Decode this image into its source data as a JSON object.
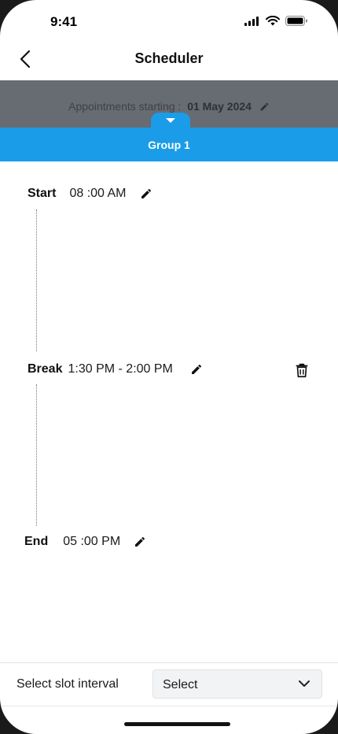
{
  "status": {
    "time": "9:41"
  },
  "header": {
    "title": "Scheduler"
  },
  "date_bar": {
    "label": "Appointments starting :",
    "date": "01 May 2024"
  },
  "group_tab": {
    "label": "Group 1"
  },
  "timeline": {
    "start": {
      "label": "Start",
      "time": "08 :00 AM"
    },
    "break": {
      "label": "Break",
      "time": "1:30 PM - 2:00 PM"
    },
    "end": {
      "label": "End",
      "time": "05 :00 PM"
    }
  },
  "slot": {
    "label": "Select slot interval",
    "selected": "Select"
  },
  "colors": {
    "accent": "#1b9ce8",
    "date_bar_bg": "#676b72"
  }
}
